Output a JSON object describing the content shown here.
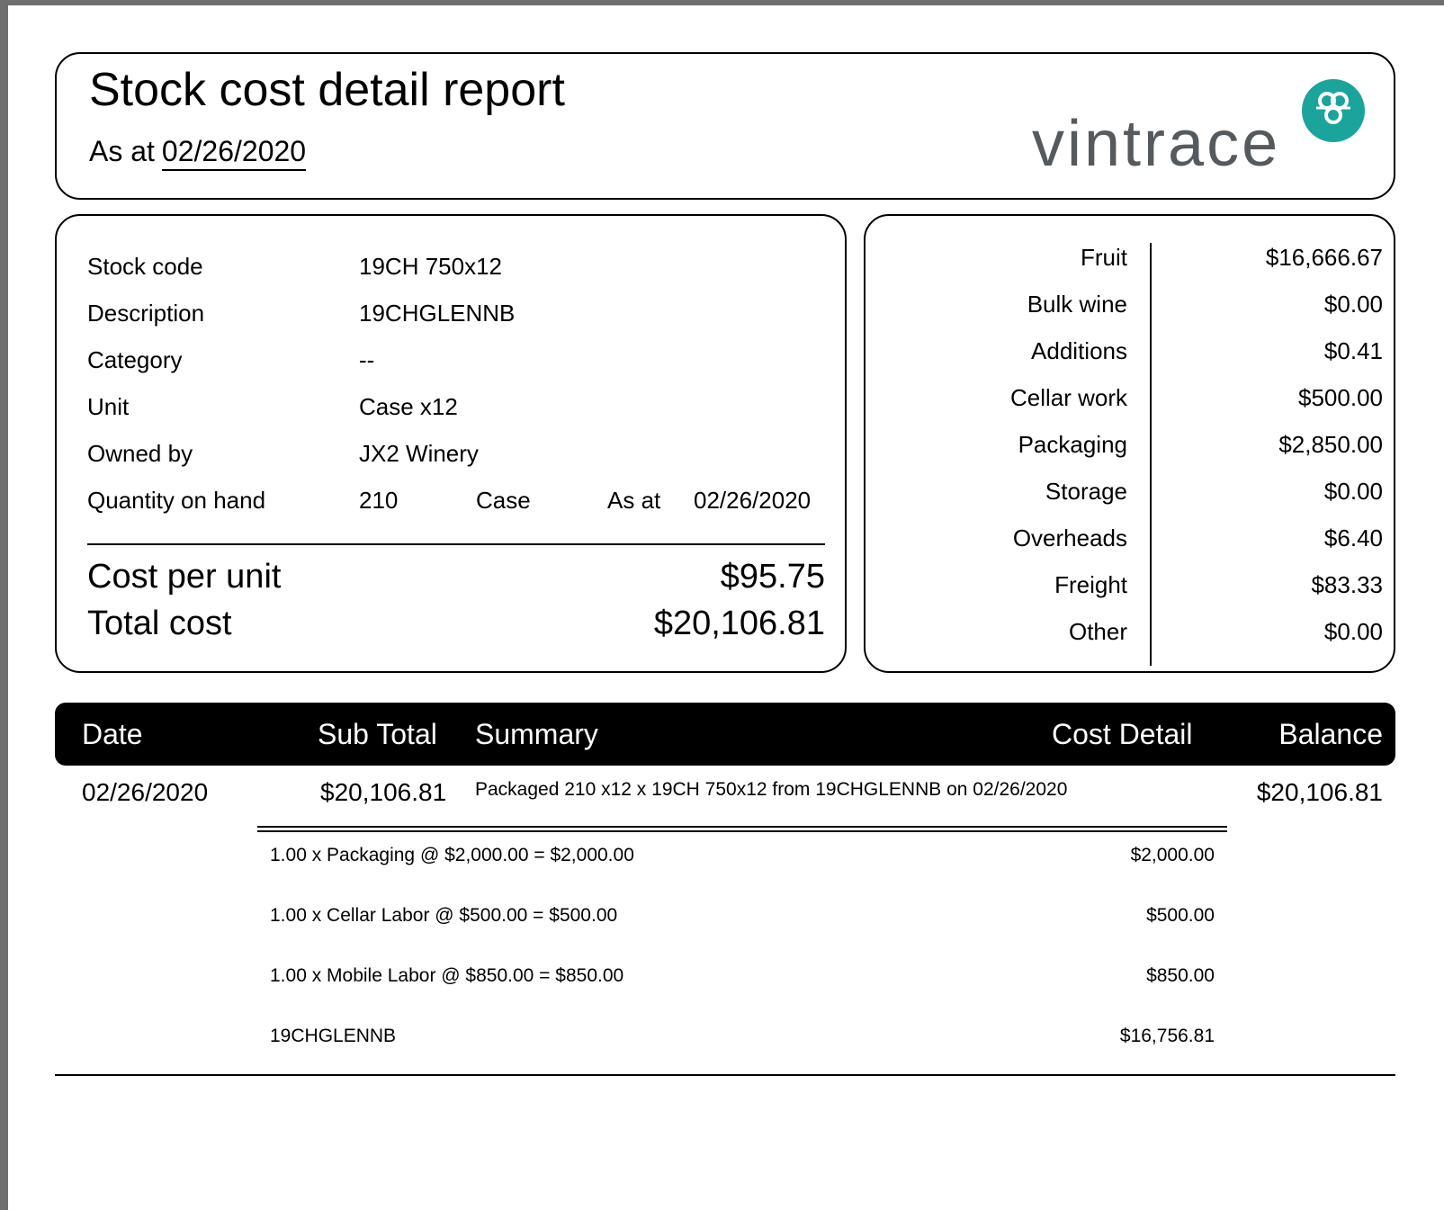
{
  "header": {
    "title": "Stock cost detail report",
    "as_at_label": "As at",
    "as_at_date": "02/26/2020",
    "logo_text": "vintrace",
    "logo_color": "#1aa49b"
  },
  "details": {
    "rows": [
      {
        "label": "Stock code",
        "value": "19CH 750x12"
      },
      {
        "label": "Description",
        "value": "19CHGLENNB"
      },
      {
        "label": "Category",
        "value": "--"
      },
      {
        "label": "Unit",
        "value": "Case x12"
      },
      {
        "label": "Owned by",
        "value": "JX2 Winery"
      }
    ],
    "quantity": {
      "label": "Quantity on hand",
      "value": "210",
      "unit": "Case",
      "as_at_label": "As at",
      "as_at_date": "02/26/2020"
    },
    "cost_per_unit_label": "Cost per unit",
    "cost_per_unit": "$95.75",
    "total_cost_label": "Total cost",
    "total_cost": "$20,106.81"
  },
  "breakdown": [
    {
      "label": "Fruit",
      "value": "$16,666.67"
    },
    {
      "label": "Bulk wine",
      "value": "$0.00"
    },
    {
      "label": "Additions",
      "value": "$0.41"
    },
    {
      "label": "Cellar work",
      "value": "$500.00"
    },
    {
      "label": "Packaging",
      "value": "$2,850.00"
    },
    {
      "label": "Storage",
      "value": "$0.00"
    },
    {
      "label": "Overheads",
      "value": "$6.40"
    },
    {
      "label": "Freight",
      "value": "$83.33"
    },
    {
      "label": "Other",
      "value": "$0.00"
    }
  ],
  "table": {
    "headers": {
      "date": "Date",
      "sub_total": "Sub Total",
      "summary": "Summary",
      "cost_detail": "Cost Detail",
      "balance": "Balance"
    },
    "row": {
      "date": "02/26/2020",
      "sub_total": "$20,106.81",
      "summary": "Packaged 210 x12 x 19CH 750x12 from 19CHGLENNB on 02/26/2020",
      "balance": "$20,106.81"
    },
    "details": [
      {
        "text": "1.00 x Packaging @ $2,000.00 = $2,000.00",
        "amount": "$2,000.00"
      },
      {
        "text": "1.00 x Cellar Labor @ $500.00 = $500.00",
        "amount": "$500.00"
      },
      {
        "text": "1.00 x Mobile Labor @ $850.00 = $850.00",
        "amount": "$850.00"
      },
      {
        "text": "19CHGLENNB",
        "amount": "$16,756.81"
      }
    ]
  }
}
